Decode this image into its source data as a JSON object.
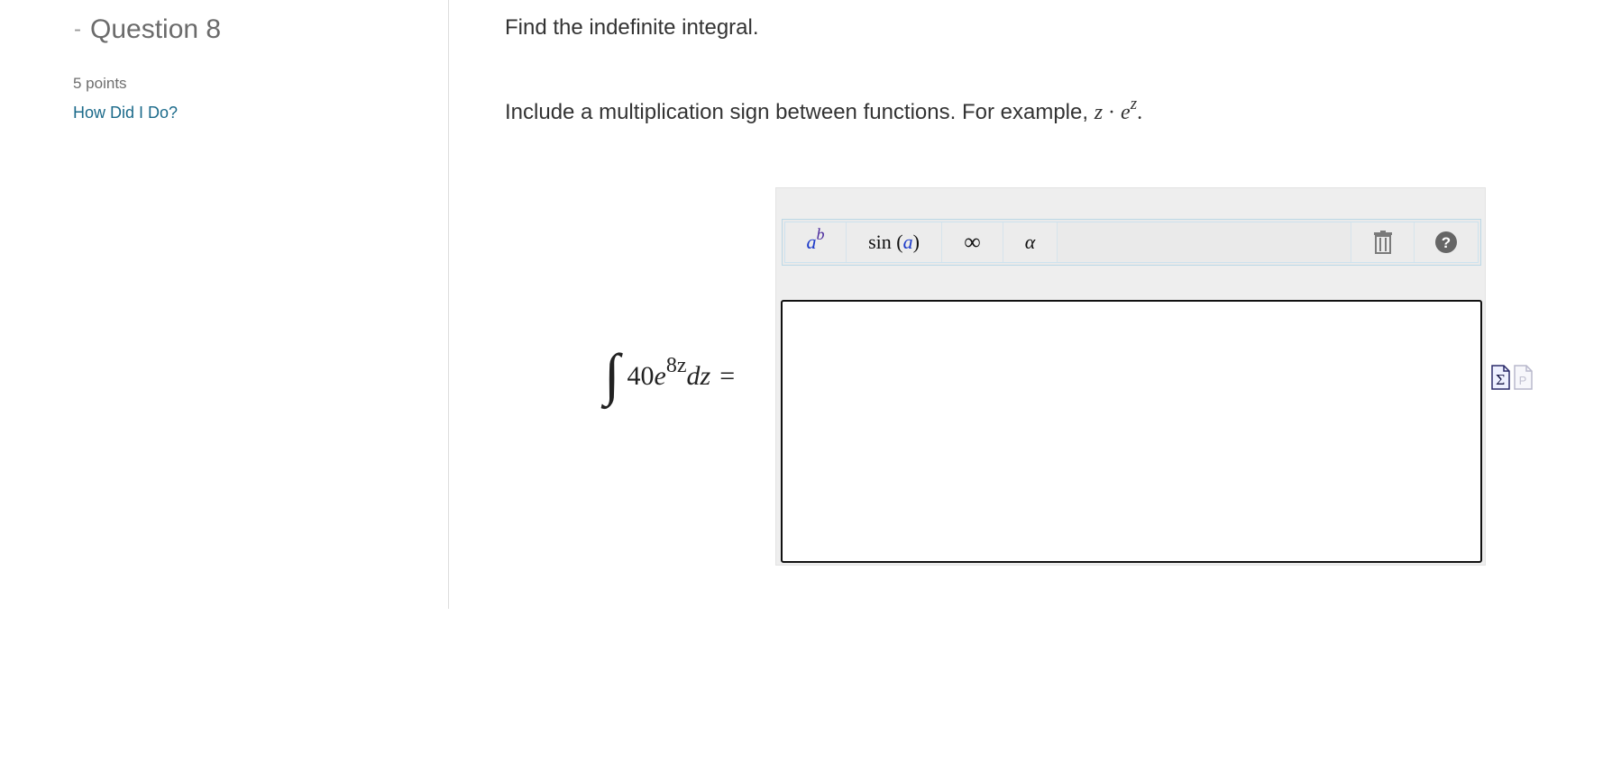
{
  "sidebar": {
    "collapse_symbol": "-",
    "question_title": "Question 8",
    "points": "5 points",
    "how_link": "How Did I Do?"
  },
  "main": {
    "prompt": "Find the indefinite integral.",
    "instruction_text": "Include a multiplication sign between functions. For example,",
    "example": {
      "z": "z",
      "dot": "·",
      "e": "e",
      "exp": "z",
      "period": "."
    },
    "expression": {
      "integral": "∫",
      "coefficient": "40",
      "base": "e",
      "exponent": "8z",
      "differential": "dz",
      "equals": "="
    }
  },
  "toolbar": {
    "power": {
      "base": "a",
      "exp": "b"
    },
    "sin": {
      "fn": "sin",
      "open": "(",
      "arg": "a",
      "close": ")"
    },
    "infinity": "∞",
    "alpha": "α"
  },
  "answer": {
    "value": ""
  },
  "icons": {
    "trash": "trash-icon",
    "help": "help-icon",
    "equation_editor": "equation-editor-icon",
    "plain_text": "plain-text-icon"
  },
  "colors": {
    "link": "#1b6a8a",
    "toolbar_border": "#bcd8e6",
    "panel_bg": "#eeeeee",
    "math_blue": "#1d3bc9",
    "math_purple": "#4b2b9d"
  }
}
